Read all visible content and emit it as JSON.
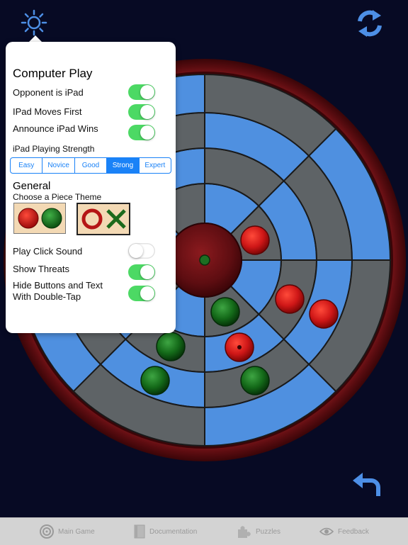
{
  "popover": {
    "computer_title": "Computer Play",
    "opponent_label": "Opponent is iPad",
    "opponent_on": true,
    "ipad_first_label": "IPad Moves First",
    "ipad_first_on": true,
    "announce_label": "Announce iPad Wins",
    "announce_on": true,
    "strength_label": "iPad Playing Strength",
    "strength_options": [
      "Easy",
      "Novice",
      "Good",
      "Strong",
      "Expert"
    ],
    "strength_selected": "Strong",
    "general_title": "General",
    "theme_label": "Choose a Piece Theme",
    "click_sound_label": "Play Click Sound",
    "click_sound_on": false,
    "show_threats_label": "Show Threats",
    "show_threats_on": true,
    "hide_buttons_label_1": "Hide Buttons and Text",
    "hide_buttons_label_2": "With Double-Tap",
    "hide_buttons_on": true
  },
  "tabs": [
    {
      "label": "Main Game",
      "icon": "target-icon"
    },
    {
      "label": "Documentation",
      "icon": "document-icon"
    },
    {
      "label": "Puzzles",
      "icon": "puzzle-icon"
    },
    {
      "label": "Feedback",
      "icon": "eye-icon"
    }
  ],
  "colors": {
    "background": "#070a24",
    "rim": "#7a1418",
    "cell_blue": "#4f90e0",
    "cell_gray": "#5e6366",
    "piece_red": "#d41c1c",
    "piece_green": "#17701e",
    "toggle_on": "#4cd964",
    "accent": "#1a82f7"
  },
  "icons": {
    "settings": "sun-icon",
    "refresh": "refresh-icon",
    "undo": "undo-icon"
  }
}
